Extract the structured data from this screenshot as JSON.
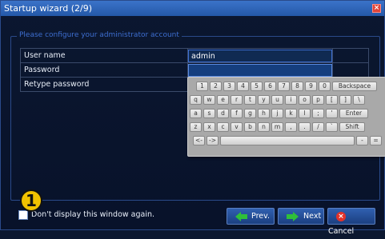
{
  "window": {
    "title": "Startup wizard (2/9)",
    "close_glyph": "×"
  },
  "group": {
    "legend": "Please configure your administrator account"
  },
  "form": {
    "rows": [
      {
        "label": "User name",
        "value": "admin"
      },
      {
        "label": "Password",
        "value": ""
      },
      {
        "label": "Retype password",
        "value": ""
      }
    ]
  },
  "keyboard": {
    "row1": [
      "1",
      "2",
      "3",
      "4",
      "5",
      "6",
      "7",
      "8",
      "9",
      "0",
      "Backspace"
    ],
    "row2": [
      "q",
      "w",
      "e",
      "r",
      "t",
      "y",
      "u",
      "i",
      "o",
      "p",
      "[",
      "]",
      "\\"
    ],
    "row3": [
      "a",
      "s",
      "d",
      "f",
      "g",
      "h",
      "j",
      "k",
      "l",
      ";",
      "'",
      "Enter"
    ],
    "row4": [
      "z",
      "x",
      "c",
      "v",
      "b",
      "n",
      "m",
      ",",
      ".",
      "/",
      "`",
      "Shift"
    ],
    "row5": [
      "<-",
      "->",
      "",
      "-",
      "="
    ]
  },
  "footer": {
    "checkbox_label": "Don't display this window again.",
    "badge": "1",
    "prev_label": "Prev.",
    "next_label": "Next",
    "cancel_label": "Cancel"
  },
  "colors": {
    "accent": "#2f62b5",
    "confirm": "#2fbf3a",
    "cancel": "#e2322a",
    "badge": "#f2c200"
  },
  "icons": {
    "prev": "arrow-left-icon",
    "next": "arrow-right-icon",
    "cancel": "x-circle-icon",
    "close": "close-icon"
  }
}
